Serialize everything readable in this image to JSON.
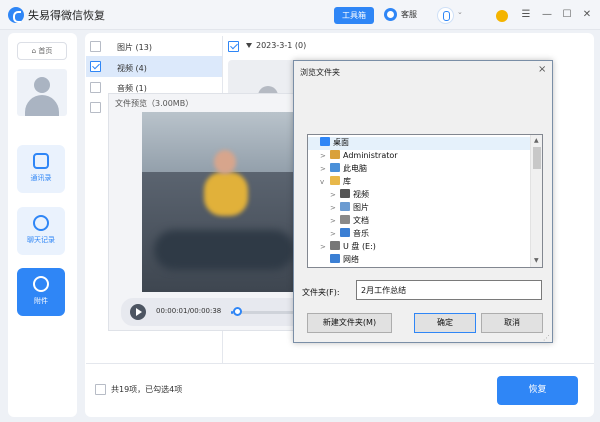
{
  "app": {
    "title": "失易得微信恢复"
  },
  "titlebar": {
    "toolbox_label": "工具箱",
    "service_label": "客服",
    "account_dropdown": "◦",
    "icons": [
      "crown-icon",
      "menu-icon",
      "minimize-icon",
      "maximize-icon",
      "close-icon"
    ]
  },
  "sidebar": {
    "home_label": "首页",
    "items": [
      {
        "label": "通讯录",
        "icon": "contacts-icon",
        "active": false
      },
      {
        "label": "聊天记录",
        "icon": "chat-icon",
        "active": false
      },
      {
        "label": "附件",
        "icon": "paperclip-icon",
        "active": true
      }
    ]
  },
  "categories": [
    {
      "label": "图片 (13)",
      "checked": false
    },
    {
      "label": "视频 (4)",
      "checked": true
    },
    {
      "label": "音频 (1)",
      "checked": false
    },
    {
      "label": "",
      "checked": false
    }
  ],
  "date_group": {
    "label": "2023-3-1 (0)",
    "checked": true
  },
  "preview": {
    "title": "文件预览（3.00MB）",
    "time": "00:00:01/00:00:38",
    "progress": 0.03
  },
  "footer": {
    "summary": "共19项，已勾选4项",
    "recover_label": "恢复"
  },
  "dialog": {
    "title": "浏览文件夹",
    "close": "×",
    "tree": [
      {
        "label": "桌面",
        "level": 0,
        "expander": "",
        "icon": "desktop-icon",
        "color": "#2f86f6",
        "selected": true
      },
      {
        "label": "Administrator",
        "level": 1,
        "expander": ">",
        "icon": "user-folder-icon",
        "color": "#d9a13a",
        "selected": false
      },
      {
        "label": "此电脑",
        "level": 1,
        "expander": ">",
        "icon": "computer-icon",
        "color": "#4a90d9",
        "selected": false
      },
      {
        "label": "库",
        "level": 1,
        "expander": "v",
        "icon": "library-icon",
        "color": "#e8b84a",
        "selected": false
      },
      {
        "label": "视频",
        "level": 2,
        "expander": ">",
        "icon": "video-folder-icon",
        "color": "#555",
        "selected": false
      },
      {
        "label": "图片",
        "level": 2,
        "expander": ">",
        "icon": "picture-folder-icon",
        "color": "#6b9bd1",
        "selected": false
      },
      {
        "label": "文档",
        "level": 2,
        "expander": ">",
        "icon": "document-folder-icon",
        "color": "#8a8a8a",
        "selected": false
      },
      {
        "label": "音乐",
        "level": 2,
        "expander": ">",
        "icon": "music-folder-icon",
        "color": "#3b7fd4",
        "selected": false
      },
      {
        "label": "U 盘 (E:)",
        "level": 1,
        "expander": ">",
        "icon": "usb-drive-icon",
        "color": "#777",
        "selected": false
      },
      {
        "label": "网络",
        "level": 1,
        "expander": "",
        "icon": "network-icon",
        "color": "#3b7fd4",
        "selected": false
      }
    ],
    "folder_label": "文件夹(F):",
    "folder_value": "2月工作总结",
    "new_folder_label": "新建文件夹(M)",
    "ok_label": "确定",
    "cancel_label": "取消"
  }
}
